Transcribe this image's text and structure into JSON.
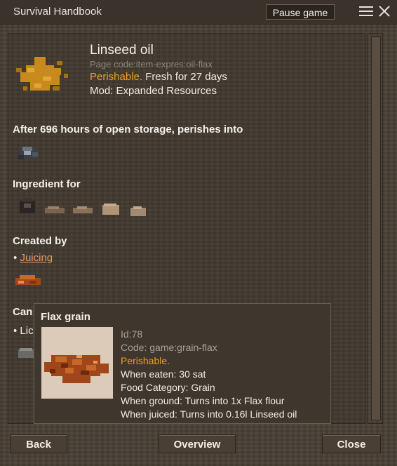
{
  "window": {
    "title": "Survival Handbook",
    "pause_label": "Pause game"
  },
  "item": {
    "name": "Linseed oil",
    "page_code": "Page code:item-expres:oil-flax",
    "perishable_label": "Perishable.",
    "fresh_text": " Fresh for 27 days",
    "mod": "Mod: Expanded Resources"
  },
  "sections": {
    "perish_heading": "After 696 hours of open storage, perishes into",
    "ingredient_heading": "Ingredient for",
    "created_heading": "Created by",
    "created_bullet": "•",
    "created_link": "Juicing",
    "can_heading": "Can",
    "can_bullet": "• Lic"
  },
  "tooltip": {
    "title": "Flax grain",
    "id": "Id:78",
    "code": "Code: game:grain-flax",
    "perishable": "Perishable.",
    "eaten": "When eaten: 30 sat",
    "category": "Food Category: Grain",
    "ground": "When ground: Turns into 1x Flax flour",
    "juiced": "When juiced: Turns into 0.16l Linseed oil"
  },
  "buttons": {
    "back": "Back",
    "overview": "Overview",
    "close": "Close"
  },
  "colors": {
    "perishable": "#e8a020",
    "link": "#e89860"
  }
}
